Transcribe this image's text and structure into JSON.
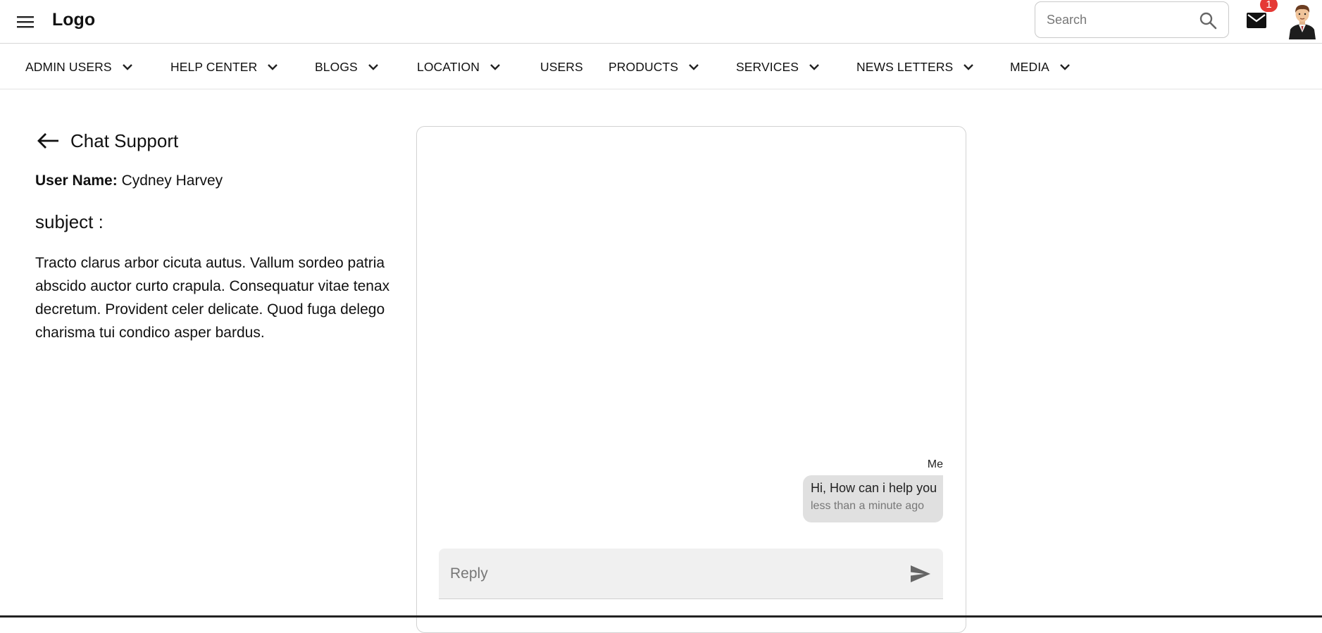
{
  "header": {
    "logo": "Logo",
    "search_placeholder": "Search",
    "mail_badge": "1",
    "icons": {
      "menu": "menu-icon",
      "search": "search-icon",
      "mail": "mail-icon",
      "avatar": "user-avatar"
    }
  },
  "nav": {
    "items": [
      {
        "label": "ADMIN USERS",
        "has_dropdown": true
      },
      {
        "label": "HELP CENTER",
        "has_dropdown": true
      },
      {
        "label": "BLOGS",
        "has_dropdown": true
      },
      {
        "label": "LOCATION",
        "has_dropdown": true
      },
      {
        "label": "USERS",
        "has_dropdown": false
      },
      {
        "label": "PRODUCTS",
        "has_dropdown": true
      },
      {
        "label": "SERVICES",
        "has_dropdown": true
      },
      {
        "label": "NEWS LETTERS",
        "has_dropdown": true
      },
      {
        "label": "MEDIA",
        "has_dropdown": true
      }
    ]
  },
  "ticket": {
    "title": "Chat Support",
    "user_name_label": "User Name:",
    "user_name": "Cydney Harvey",
    "subject_label": "subject :",
    "description": "Tracto clarus arbor cicuta autus. Vallum sordeo patria abscido auctor curto crapula. Consequatur vitae tenax decretum. Provident celer delicate. Quod fuga delego charisma tui condico asper bardus."
  },
  "chat": {
    "messages": [
      {
        "sender": "Me",
        "text": "Hi, How can i help you",
        "time": "less than a minute ago"
      }
    ],
    "reply_placeholder": "Reply"
  },
  "colors": {
    "badge": "#e53935",
    "bubble": "#e0e0e0",
    "reply_bg": "#f0f0f0"
  }
}
